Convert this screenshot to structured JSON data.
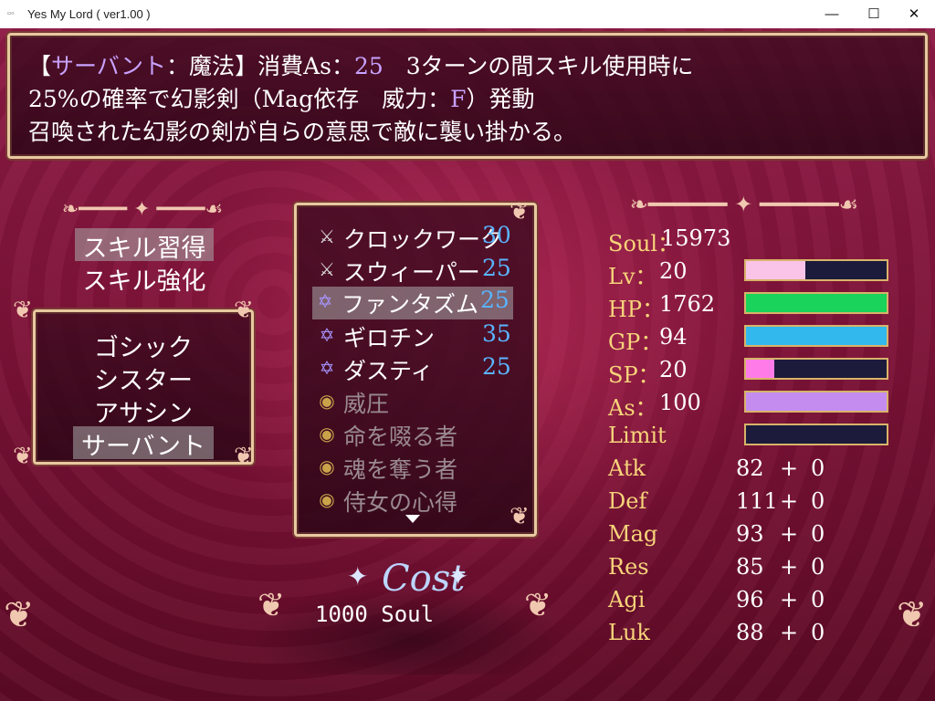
{
  "window": {
    "title": "Yes My Lord ( ver1.00 )",
    "controls": {
      "minimize": "—",
      "maximize": "☐",
      "close": "✕"
    }
  },
  "help": {
    "line1": {
      "bracket_open": "【",
      "category": "サーバント",
      "sep": "：",
      "type": "魔法",
      "bracket_close": "】",
      "cost_label": "消費As：",
      "cost": "25",
      "rest": "　3ターンの間スキル使用時に"
    },
    "line2": {
      "pre": "25%の確率で幻影剣（Mag依存　威力：",
      "power": "F",
      "post": "）発動"
    },
    "line3": "召喚された幻影の剣が自らの意思で敵に襲い掛かる。"
  },
  "commands": [
    "スキル習得",
    "スキル強化"
  ],
  "classes": [
    "ゴシック",
    "シスター",
    "アサシン",
    "サーバント"
  ],
  "skills": [
    {
      "icon": "crossed-swords-icon",
      "name": "クロックワーク",
      "cost": "30"
    },
    {
      "icon": "crossed-swords-icon",
      "name": "スウィーパー",
      "cost": "25"
    },
    {
      "icon": "hexagram-icon",
      "name": "ファンタズム",
      "cost": "25"
    },
    {
      "icon": "hexagram-icon",
      "name": "ギロチン",
      "cost": "35"
    },
    {
      "icon": "hexagram-icon",
      "name": "ダスティ",
      "cost": "25"
    },
    {
      "icon": "passive-orb-icon",
      "name": "威圧",
      "cost": ""
    },
    {
      "icon": "passive-orb-icon",
      "name": "命を啜る者",
      "cost": ""
    },
    {
      "icon": "passive-orb-icon",
      "name": "魂を奪う者",
      "cost": ""
    },
    {
      "icon": "passive-orb-icon",
      "name": "侍女の心得",
      "cost": ""
    }
  ],
  "cost": {
    "title": "Cost",
    "value": "1000 Soul"
  },
  "status": {
    "soul": {
      "label": "Soul：",
      "value": "15973"
    },
    "lv": {
      "label": "Lv：",
      "value": "20",
      "fill": 0.42,
      "color": "#f9c4e8"
    },
    "hp": {
      "label": "HP：",
      "value": "1762",
      "fill": 1.0,
      "color": "#19d35a"
    },
    "gp": {
      "label": "GP：",
      "value": "94",
      "fill": 1.0,
      "color": "#33b8ee"
    },
    "sp": {
      "label": "SP：",
      "value": "20",
      "fill": 0.2,
      "color": "#ff7ce8"
    },
    "as": {
      "label": "As：",
      "value": "100",
      "fill": 1.0,
      "color": "#c58cf0"
    },
    "limit": {
      "label": "Limit",
      "fill": 0.0,
      "color": "#ff9a3a"
    },
    "params": [
      {
        "label": "Atk",
        "base": "82",
        "plus": "+",
        "bonus": "0"
      },
      {
        "label": "Def",
        "base": "111",
        "plus": "+",
        "bonus": "0"
      },
      {
        "label": "Mag",
        "base": "93",
        "plus": "+",
        "bonus": "0"
      },
      {
        "label": "Res",
        "base": "85",
        "plus": "+",
        "bonus": "0"
      },
      {
        "label": "Agi",
        "base": "96",
        "plus": "+",
        "bonus": "0"
      },
      {
        "label": "Luk",
        "base": "88",
        "plus": "+",
        "bonus": "0"
      }
    ]
  }
}
